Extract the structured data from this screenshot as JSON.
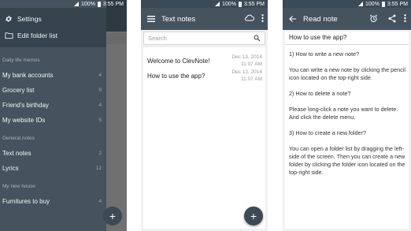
{
  "status_bar": {
    "battery": "100%",
    "time": "3:55 PM"
  },
  "drawer": {
    "settings_label": "Settings",
    "edit_folder_label": "Edit folder list",
    "sections": [
      {
        "title": "Daily life memos",
        "items": [
          {
            "label": "My bank accounts",
            "count": "4"
          },
          {
            "label": "Grocery list",
            "count": "9"
          },
          {
            "label": "Friend's birthday",
            "count": "4"
          },
          {
            "label": "My website IDs",
            "count": "5"
          }
        ]
      },
      {
        "title": "General notes",
        "items": [
          {
            "label": "Text notes",
            "count": "2"
          },
          {
            "label": "Lyrics",
            "count": "12"
          }
        ]
      },
      {
        "title": "My new house",
        "items": [
          {
            "label": "Furnitures to buy",
            "count": "4"
          }
        ]
      }
    ],
    "peek_fab": "+"
  },
  "list_screen": {
    "title": "Text notes",
    "search_placeholder": "Search",
    "notes": [
      {
        "title": "Welcome to ClevNote!",
        "date": "Dec 13, 2014",
        "time": "11:07 AM"
      },
      {
        "title": "How to use the app?",
        "date": "Dec 13, 2014",
        "time": "11:07 AM"
      }
    ],
    "fab": "+"
  },
  "read_screen": {
    "title": "Read note",
    "note_title": "How to use the app?",
    "paragraphs": [
      "1) How to write a new note?",
      "You can write a new note by clicking the pencil icon located on the top-right side.",
      "2) How to delete a note?",
      "Please long-click a note you want to delete. And click the delete menu.",
      "3) How to create a new folder?",
      "You can open a folder list by dragging the left-side of the screen. Then you can create a new folder by clicking the folder icon located on the top-right side."
    ]
  },
  "colors": {
    "primary": "#44535d",
    "primary_dark": "#3a4a56",
    "accent_fab": "#3b4a55",
    "background": "#f1f1f1"
  },
  "icons": [
    "gear-icon",
    "folder-icon",
    "menu-icon",
    "cloud-icon",
    "search-icon",
    "back-arrow-icon",
    "alarm-icon",
    "share-icon",
    "more-vert-icon",
    "add-icon",
    "signal-icon",
    "battery-icon"
  ]
}
